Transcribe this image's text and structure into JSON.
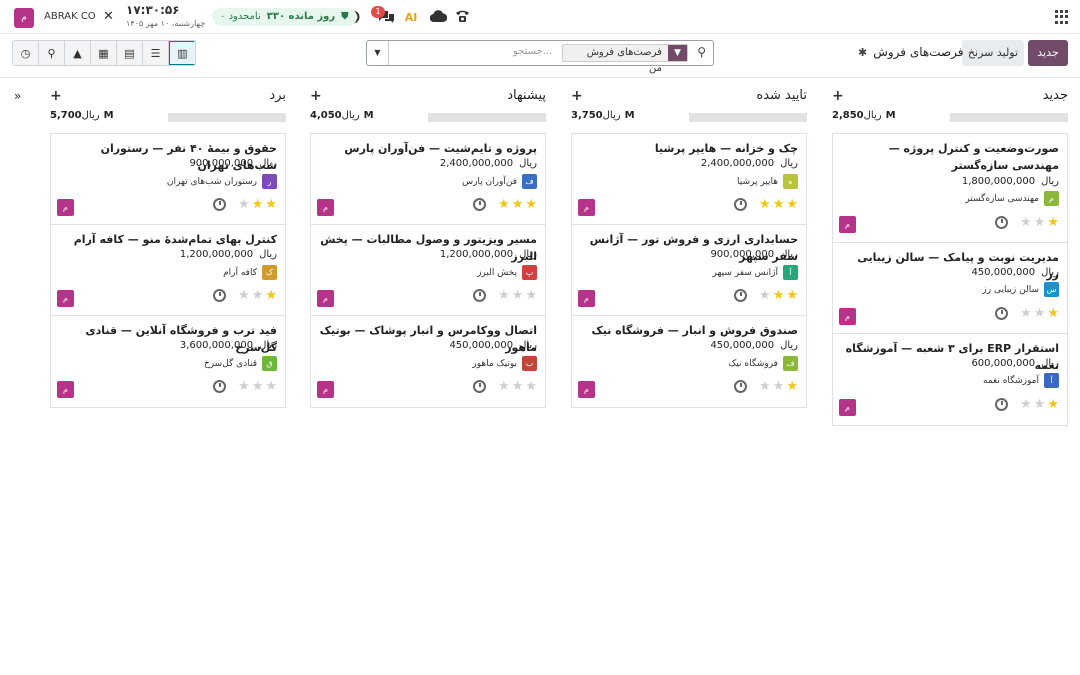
{
  "topbar": {
    "brand_letter": "م",
    "company": "ABRAK CO",
    "time": "۱۷:۳۰:۵۶",
    "date": "چهارشنبه، ۱۰ مهر ۱۴۰۵",
    "trial_days": "۳۳۰ روز مانده",
    "trial_plan": "۰ نامحدود",
    "chat_badge": "1",
    "ai_label": "AI"
  },
  "control": {
    "new_label": "جدید",
    "generate_label": "تولید سرنخ",
    "breadcrumb": "فرصت‌های فروش",
    "facet_label": "فرصت‌های فروش من",
    "search_placeholder": "جستجو..."
  },
  "colors": {
    "primary": "#714b67",
    "accent": "#017e84",
    "star": "#f3c613"
  },
  "columns": [
    {
      "title": "جدید",
      "sum": "2,850M",
      "currency": "ریال",
      "cards": [
        {
          "title": "صورت‌وضعیت و کنترل پروژه — مهندسی سازه‌گستر",
          "currency": "ریال",
          "amount": "1,800,000,000",
          "customer": "مهندسی سازه‌گستر",
          "avatar": "م",
          "avatar_color": "#8bb73b",
          "stars": 1,
          "owner": "م"
        },
        {
          "title": "مدیریت نوبت و پیامک — سالن زیبایی رز",
          "currency": "ریال",
          "amount": "450,000,000",
          "customer": "سالن زیبایی رز",
          "avatar": "س",
          "avatar_color": "#1e8fd1",
          "stars": 1,
          "owner": "م"
        },
        {
          "title": "استقرار ERP برای ۳ شعبه — آموزشگاه نغمه",
          "currency": "ریال",
          "amount": "600,000,000",
          "customer": "آموزشگاه نغمه",
          "avatar": "آ",
          "avatar_color": "#3a68c4",
          "stars": 1,
          "owner": "م"
        }
      ]
    },
    {
      "title": "تایید شده",
      "sum": "3,750M",
      "currency": "ریال",
      "cards": [
        {
          "title": "چک و خزانه — هایپر پرشیا",
          "currency": "ریال",
          "amount": "2,400,000,000",
          "customer": "هایپر پرشیا",
          "avatar": "ه",
          "avatar_color": "#b9c33d",
          "stars": 3,
          "owner": "م"
        },
        {
          "title": "حسابداری ارزی و فروش تور — آژانس سفر سپهر",
          "currency": "ریال",
          "amount": "900,000,000",
          "customer": "آژانس سفر سپهر",
          "avatar": "آ",
          "avatar_color": "#27a67a",
          "stars": 2,
          "owner": "م"
        },
        {
          "title": "صندوق فروش و انبار — فروشگاه نیک",
          "currency": "ریال",
          "amount": "450,000,000",
          "customer": "فروشگاه نیک",
          "avatar": "ف",
          "avatar_color": "#8bb73b",
          "stars": 1,
          "owner": "م"
        }
      ]
    },
    {
      "title": "پیشنهاد",
      "sum": "4,050M",
      "currency": "ریال",
      "cards": [
        {
          "title": "پروژه و تایم‌شیت — فن‌آوران پارس",
          "currency": "ریال",
          "amount": "2,400,000,000",
          "customer": "فن‌آوران پارس",
          "avatar": "ف",
          "avatar_color": "#3a6fc4",
          "stars": 3,
          "owner": "م"
        },
        {
          "title": "مسیر ویزیتور و وصول مطالبات — پخش البرز",
          "currency": "ریال",
          "amount": "1,200,000,000",
          "customer": "پخش البرز",
          "avatar": "پ",
          "avatar_color": "#d23f3f",
          "stars": 0,
          "owner": "م"
        },
        {
          "title": "اتصال ووکامرس و انبار پوشاک — بوتیک ماهور",
          "currency": "ریال",
          "amount": "450,000,000",
          "customer": "بوتیک ماهور",
          "avatar": "ب",
          "avatar_color": "#c2453c",
          "stars": 0,
          "owner": "م"
        }
      ]
    },
    {
      "title": "برد",
      "sum": "5,700M",
      "currency": "ریال",
      "cards": [
        {
          "title": "حقوق و بیمهٔ ۴۰ نفر — رستوران شب‌های تهران",
          "currency": "ریال",
          "amount": "900,000,000",
          "customer": "رستوران شب‌های تهران",
          "avatar": "ر",
          "avatar_color": "#7b4bb8",
          "stars": 2,
          "owner": "م"
        },
        {
          "title": "کنترل بهای تمام‌شدهٔ منو — کافه آرام",
          "currency": "ریال",
          "amount": "1,200,000,000",
          "customer": "کافه آرام",
          "avatar": "ک",
          "avatar_color": "#d19b2b",
          "stars": 1,
          "owner": "م"
        },
        {
          "title": "فید ترب و فروشگاه آنلاین — قنادی گل‌سرخ",
          "currency": "ریال",
          "amount": "3,600,000,000",
          "customer": "قنادی گل‌سرخ",
          "avatar": "ق",
          "avatar_color": "#6fb73b",
          "stars": 0,
          "owner": "م"
        }
      ]
    }
  ]
}
